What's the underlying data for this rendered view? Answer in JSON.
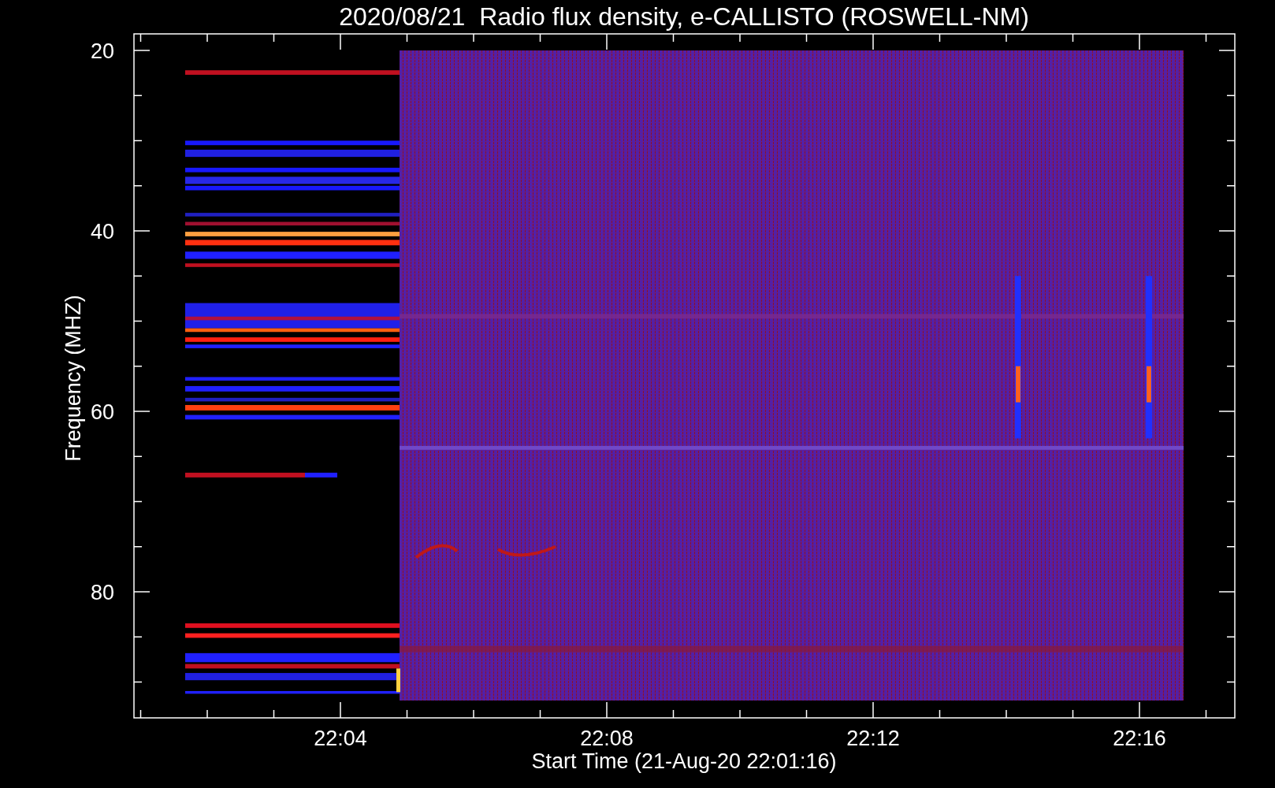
{
  "title": "2020/08/21  Radio flux density, e-CALLISTO (ROSWELL-NM)",
  "y_axis": {
    "label": "Frequency (MHZ)",
    "ticks": [
      "20",
      "40",
      "60",
      "80"
    ]
  },
  "x_axis": {
    "label": "Start Time (21-Aug-20 22:01:16)",
    "ticks": [
      "22:04",
      "22:08",
      "22:12",
      "22:16"
    ]
  }
}
